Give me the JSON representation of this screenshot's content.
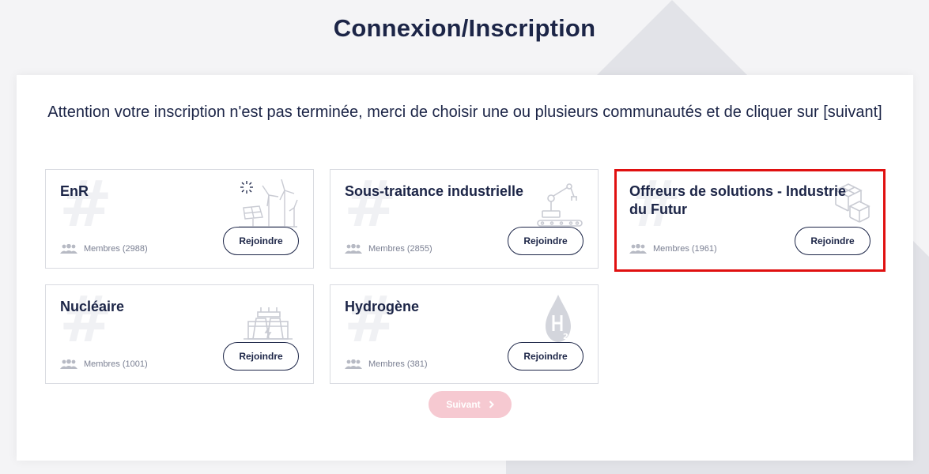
{
  "page": {
    "title": "Connexion/Inscription",
    "notice": "Attention votre inscription n'est pas terminée, merci de choisir une ou plusieurs communautés et de cliquer sur [suivant]"
  },
  "communities": [
    {
      "name": "EnR",
      "members": "Membres (2988)",
      "join_label": "Rejoindre",
      "icon": "renewable-energy-icon"
    },
    {
      "name": "Sous-traitance industrielle",
      "members": "Membres (2855)",
      "join_label": "Rejoindre",
      "icon": "robot-arm-icon"
    },
    {
      "name": "Offreurs de solutions - Industrie du Futur",
      "members": "Membres (1961)",
      "join_label": "Rejoindre",
      "icon": "cubes-icon",
      "highlighted": true
    },
    {
      "name": "Nucléaire",
      "members": "Membres (1001)",
      "join_label": "Rejoindre",
      "icon": "power-plant-icon"
    },
    {
      "name": "Hydrogène",
      "members": "Membres (381)",
      "join_label": "Rejoindre",
      "icon": "hydrogen-drop-icon"
    }
  ],
  "next_button": {
    "label": "Suivant",
    "icon": "chevron-right-icon",
    "state": "disabled"
  },
  "colors": {
    "primary": "#1c2547",
    "next_disabled": "#f6c9d1",
    "highlight": "#e01010"
  }
}
